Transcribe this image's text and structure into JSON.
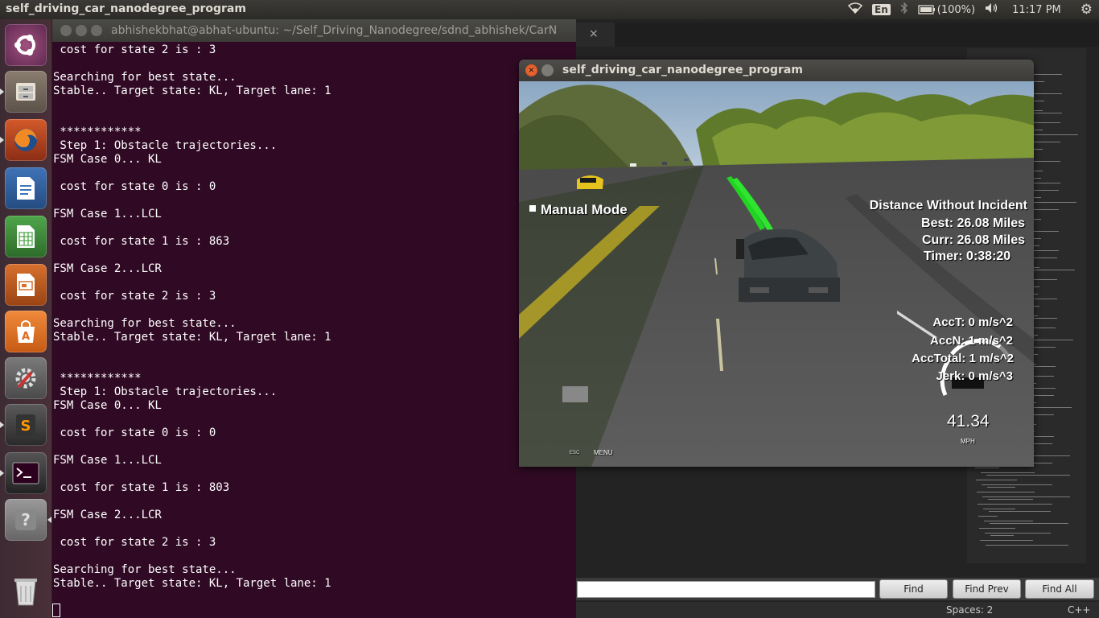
{
  "topbar": {
    "app_title": "self_driving_car_nanodegree_program",
    "lang": "En",
    "battery": "(100%)",
    "clock": "11:17 PM"
  },
  "launcher": {
    "items": [
      "ubuntu-dash",
      "files",
      "firefox",
      "libreoffice-writer",
      "libreoffice-calc",
      "libreoffice-impress",
      "ubuntu-software",
      "system-settings",
      "sublime-text",
      "terminal",
      "help",
      "trash"
    ]
  },
  "terminal": {
    "title": "abhishekbhat@abhat-ubuntu: ~/Self_Driving_Nanodegree/sdnd_abhishek/CarN",
    "lines": [
      " cost for state 2 is : 3",
      "",
      "Searching for best state...",
      "Stable.. Target state: KL, Target lane: 1",
      "",
      "",
      " ************",
      " Step 1: Obstacle trajectories...",
      "FSM Case 0... KL",
      "",
      " cost for state 0 is : 0",
      "",
      "FSM Case 1...LCL",
      "",
      " cost for state 1 is : 863",
      "",
      "FSM Case 2...LCR",
      "",
      " cost for state 2 is : 3",
      "",
      "Searching for best state...",
      "Stable.. Target state: KL, Target lane: 1",
      "",
      "",
      " ************",
      " Step 1: Obstacle trajectories...",
      "FSM Case 0... KL",
      "",
      " cost for state 0 is : 0",
      "",
      "FSM Case 1...LCL",
      "",
      " cost for state 1 is : 803",
      "",
      "FSM Case 2...LCR",
      "",
      " cost for state 2 is : 3",
      "",
      "Searching for best state...",
      "Stable.. Target state: KL, Target lane: 1"
    ]
  },
  "editor": {
    "tab_close": "×",
    "find_buttons": [
      "Find",
      "Find Prev",
      "Find All"
    ],
    "status_spaces": "Spaces: 2",
    "status_lang": "C++"
  },
  "simulator": {
    "title": "self_driving_car_nanodegree_program",
    "close_glyph": "×",
    "mode": "Manual Mode",
    "distance_heading": "Distance Without Incident",
    "best": "Best: 26.08 Miles",
    "curr": "Curr: 26.08 Miles",
    "timer": "Timer: 0:38:20",
    "acc_t": "AccT: 0 m/s^2",
    "acc_n": "AccN: 1 m/s^2",
    "acc_total": "AccTotal: 1 m/s^2",
    "jerk": "Jerk: 0 m/s^3",
    "speed": "41.34",
    "speed_unit": "MPH",
    "esc_label": "ESC",
    "menu_label": "MENU"
  }
}
